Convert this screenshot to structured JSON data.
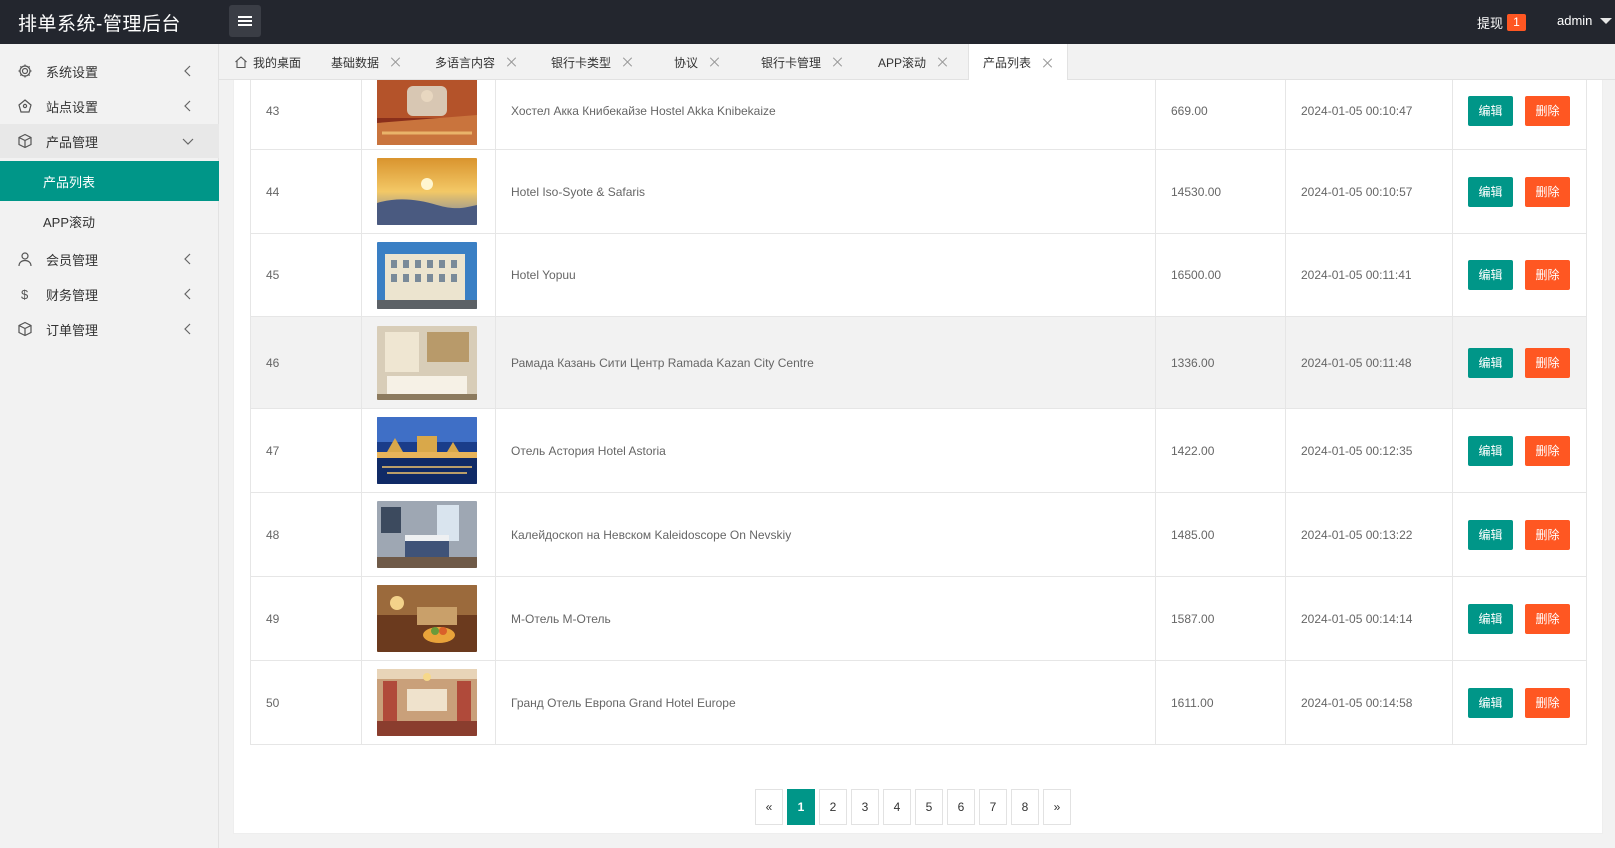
{
  "app": {
    "title": "排单系统-管理后台"
  },
  "header": {
    "withdraw_label": "提现",
    "withdraw_count": "1",
    "user": "admin"
  },
  "sidebar": {
    "items": [
      {
        "label": "系统设置"
      },
      {
        "label": "站点设置"
      },
      {
        "label": "产品管理"
      },
      {
        "label": "会员管理"
      },
      {
        "label": "财务管理"
      },
      {
        "label": "订单管理"
      }
    ],
    "sub_items": [
      {
        "label": "产品列表"
      },
      {
        "label": "APP滚动"
      }
    ]
  },
  "tabs": [
    {
      "label": "我的桌面"
    },
    {
      "label": "基础数据"
    },
    {
      "label": "多语言内容"
    },
    {
      "label": "银行卡类型"
    },
    {
      "label": "协议"
    },
    {
      "label": "银行卡管理"
    },
    {
      "label": "APP滚动"
    },
    {
      "label": "产品列表"
    }
  ],
  "table": {
    "actions": {
      "edit": "编辑",
      "delete": "删除"
    },
    "rows": [
      {
        "id": "43",
        "name": "Хостел Акка Книбекайзе Hostel Akka Knibekaize",
        "price": "669.00",
        "time": "2024-01-05 00:10:47"
      },
      {
        "id": "44",
        "name": "Hotel Iso-Syote & Safaris",
        "price": "14530.00",
        "time": "2024-01-05 00:10:57"
      },
      {
        "id": "45",
        "name": "Hotel Yopuu",
        "price": "16500.00",
        "time": "2024-01-05 00:11:41"
      },
      {
        "id": "46",
        "name": "Рамада Казань Сити Центр Ramada Kazan City Centre",
        "price": "1336.00",
        "time": "2024-01-05 00:11:48"
      },
      {
        "id": "47",
        "name": "Отель Астория Hotel Astoria",
        "price": "1422.00",
        "time": "2024-01-05 00:12:35"
      },
      {
        "id": "48",
        "name": "Калейдоскоп на Невском Kaleidoscope On Nevskiy",
        "price": "1485.00",
        "time": "2024-01-05 00:13:22"
      },
      {
        "id": "49",
        "name": "М-Отель M-Отель",
        "price": "1587.00",
        "time": "2024-01-05 00:14:14"
      },
      {
        "id": "50",
        "name": "Гранд Отель Европа Grand Hotel Europe",
        "price": "1611.00",
        "time": "2024-01-05 00:14:58"
      }
    ]
  },
  "pagination": {
    "prev": "«",
    "next": "»",
    "pages": [
      "1",
      "2",
      "3",
      "4",
      "5",
      "6",
      "7",
      "8"
    ],
    "current": "1"
  },
  "colors": {
    "primary": "#009688",
    "danger": "#ff5722",
    "header_bg": "#23262e"
  }
}
